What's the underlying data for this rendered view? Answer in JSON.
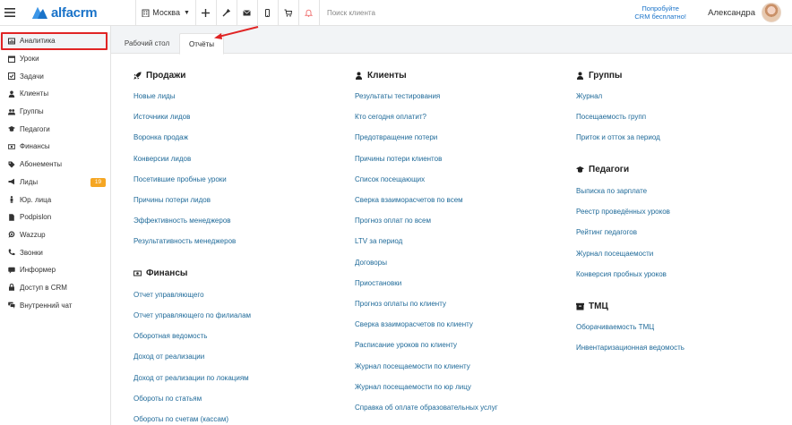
{
  "header": {
    "logo_text": "alfacrm",
    "city": "Москва",
    "search_placeholder": "Поиск клиента",
    "promo_line1": "Попробуйте",
    "promo_line2": "CRM бесплатно!",
    "user_name": "Александра"
  },
  "sidebar": {
    "items": [
      {
        "label": "Аналитика",
        "icon": "analytics-icon"
      },
      {
        "label": "Уроки",
        "icon": "calendar-icon"
      },
      {
        "label": "Задачи",
        "icon": "tasks-icon"
      },
      {
        "label": "Клиенты",
        "icon": "user-icon"
      },
      {
        "label": "Группы",
        "icon": "group-icon"
      },
      {
        "label": "Педагоги",
        "icon": "graduation-cap-icon"
      },
      {
        "label": "Финансы",
        "icon": "money-icon"
      },
      {
        "label": "Абонементы",
        "icon": "tag-icon"
      },
      {
        "label": "Лиды",
        "icon": "megaphone-icon",
        "badge": "19"
      },
      {
        "label": "Юр. лица",
        "icon": "person-icon"
      },
      {
        "label": "Podpislon",
        "icon": "document-icon"
      },
      {
        "label": "Wazzup",
        "icon": "whatsapp-icon"
      },
      {
        "label": "Звонки",
        "icon": "phone-icon"
      },
      {
        "label": "Информер",
        "icon": "chat-icon"
      },
      {
        "label": "Доступ в CRM",
        "icon": "lock-icon"
      },
      {
        "label": "Внутренний чат",
        "icon": "comments-icon"
      }
    ]
  },
  "tabs": {
    "desk": "Рабочий стол",
    "reports": "Отчёты"
  },
  "sections": {
    "sales": {
      "title": "Продажи",
      "links": [
        "Новые лиды",
        "Источники лидов",
        "Воронка продаж",
        "Конверсии лидов",
        "Посетившие пробные уроки",
        "Причины потери лидов",
        "Эффективность менеджеров",
        "Результативность менеджеров"
      ]
    },
    "finance": {
      "title": "Финансы",
      "links": [
        "Отчет управляющего",
        "Отчет управляющего по филиалам",
        "Оборотная ведомость",
        "Доход от реализации",
        "Доход от реализации по локациям",
        "Обороты по статьям",
        "Обороты по счетам (кассам)"
      ]
    },
    "clients": {
      "title": "Клиенты",
      "links": [
        "Результаты тестирования",
        "Кто сегодня оплатит?",
        "Предотвращение потери",
        "Причины потери клиентов",
        "Список посещающих",
        "Сверка взаиморасчетов по всем",
        "Прогноз оплат по всем",
        "LTV за период",
        "Договоры",
        "Приостановки",
        "Прогноз оплаты по клиенту",
        "Сверка взаиморасчетов по клиенту",
        "Расписание уроков по клиенту",
        "Журнал посещаемости по клиенту",
        "Журнал посещаемости по юр лицу",
        "Справка об оплате образовательных услуг"
      ]
    },
    "groups": {
      "title": "Группы",
      "links": [
        "Журнал",
        "Посещаемость групп",
        "Приток и отток за период"
      ]
    },
    "teachers": {
      "title": "Педагоги",
      "links": [
        "Выписка по зарплате",
        "Реестр проведённых уроков",
        "Рейтинг педагогов",
        "Журнал посещаемости",
        "Конверсия пробных уроков"
      ]
    },
    "tmc": {
      "title": "ТМЦ",
      "links": [
        "Оборачиваемость ТМЦ",
        "Инвентаризационная ведомость"
      ]
    }
  },
  "colors": {
    "accent": "#1a73c9",
    "link": "#1f6a99",
    "highlight": "#e02424",
    "badge": "#f5a623"
  }
}
